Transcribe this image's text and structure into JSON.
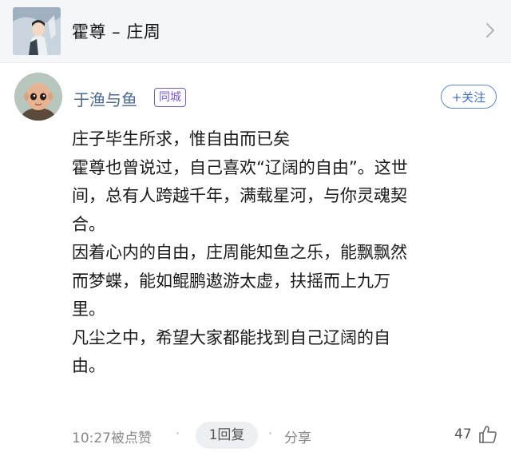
{
  "song_card": {
    "title": "霍尊 – 庄周"
  },
  "comment": {
    "username": "于渔与鱼",
    "tag": "同城",
    "follow_label": "+关注",
    "lines": [
      "庄子毕生所求，惟自由而已矣",
      "霍尊也曾说过，自己喜欢“辽阔的自由”。这世",
      "间，总有人跨越千年，满载星河，与你灵魂契",
      "合。",
      "因着心内的自由，庄周能知鱼之乐，能飘飘然",
      "而梦蝶，能如鲲鹏遨游太虚，扶摇而上九万",
      "里。",
      "凡尘之中，希望大家都能找到自己辽阔的自",
      "由。"
    ]
  },
  "footer": {
    "time_text": "10:27被点赞",
    "reply_label": "1回复",
    "dot_1": "·",
    "dot_2": "·",
    "share_label": "分享",
    "like_count": "47"
  },
  "colors": {
    "username": "#4a6a94",
    "tag": "#7a5bd6",
    "follow": "#3f6fd0",
    "card_bg": "#f5f6f8"
  }
}
